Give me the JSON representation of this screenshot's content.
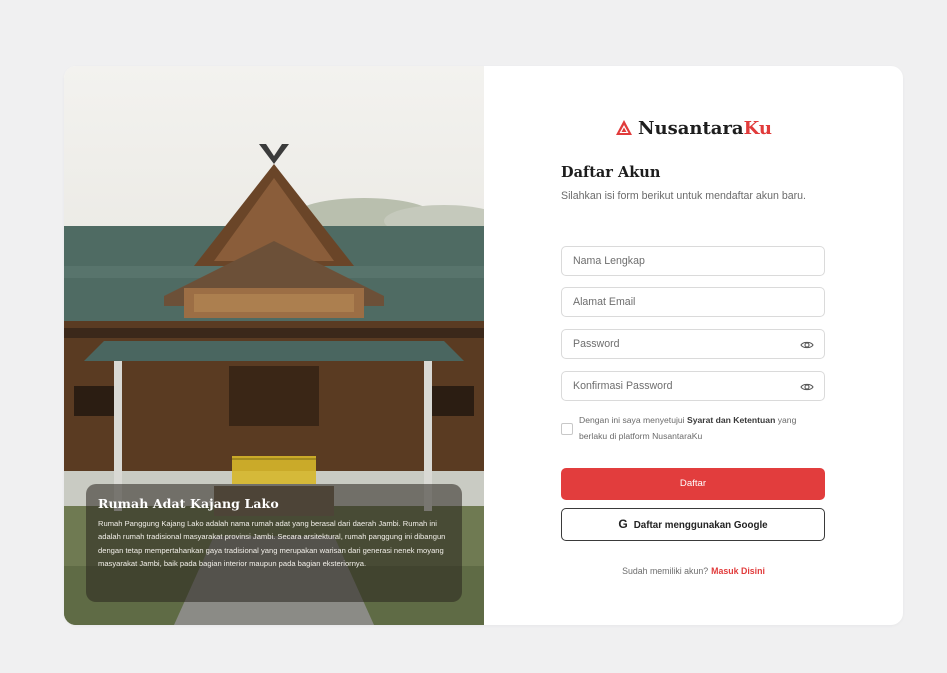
{
  "brand": {
    "name_main": "Nusantara",
    "name_accent": "Ku",
    "accent_color": "#e13b3b"
  },
  "hero": {
    "title": "Rumah Adat Kajang Lako",
    "description": "Rumah Panggung Kajang Lako adalah nama rumah adat yang berasal dari daerah Jambi. Rumah ini adalah rumah tradisional masyarakat provinsi Jambi. Secara arsitektural, rumah panggung ini dibangun dengan tetap mempertahankan gaya tradisional yang merupakan warisan dari generasi nenek moyang masyarakat Jambi, baik pada bagian interior maupun pada bagian eksteriornya."
  },
  "form": {
    "title": "Daftar Akun",
    "subtitle": "Silahkan isi form berikut untuk mendaftar akun baru.",
    "fields": {
      "name_placeholder": "Nama Lengkap",
      "email_placeholder": "Alamat Email",
      "password_placeholder": "Password",
      "confirm_password_placeholder": "Konfirmasi Password"
    },
    "agree": {
      "prefix": "Dengan ini saya menyetujui ",
      "terms": "Syarat dan Ketentuan",
      "suffix": " yang berlaku di platform NusantaraKu"
    },
    "submit_label": "Daftar",
    "google_label": "Daftar menggunakan Google",
    "google_icon": "G",
    "login_prompt": "Sudah memiliki akun?",
    "login_link": "Masuk Disini"
  },
  "icons": {
    "logo": "nusantaraku-logo-icon",
    "eye": "eye-icon",
    "google": "google-icon"
  },
  "colors": {
    "primary": "#e23d3d",
    "background": "#f0f0f1"
  }
}
